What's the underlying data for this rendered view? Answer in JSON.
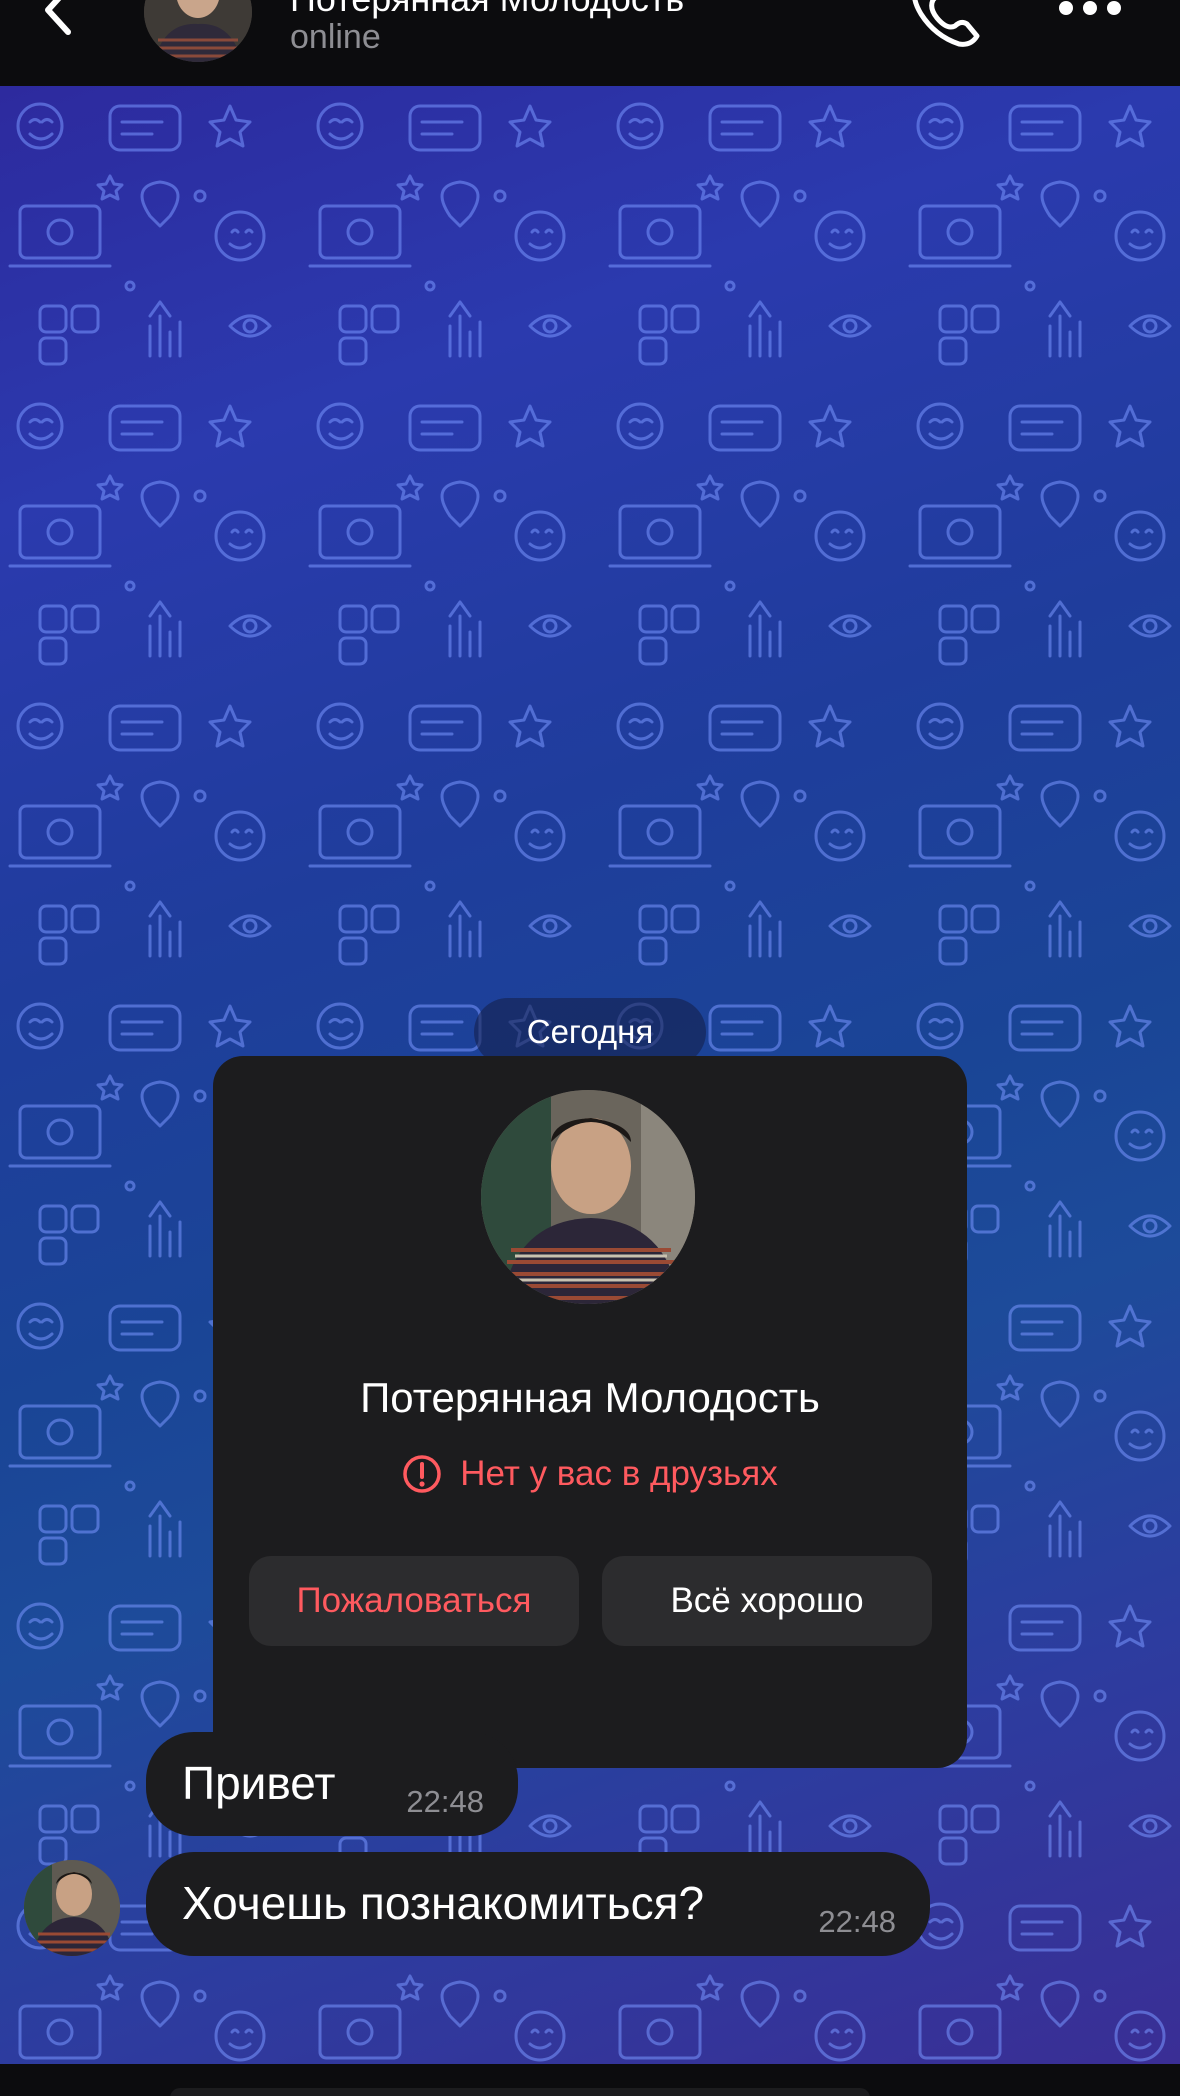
{
  "header": {
    "title": "Потерянная Молодость",
    "status": "online",
    "back_icon": "chevron-left-icon",
    "call_icon": "phone-icon",
    "more_icon": "ellipsis-icon"
  },
  "chat": {
    "date_separator": "Сегодня",
    "contact_card": {
      "name": "Потерянная Молодость",
      "warning": "Нет у вас в друзьях",
      "warning_icon": "exclamation-circle-icon",
      "report_button": "Пожаловаться",
      "ok_button": "Всё хорошо"
    },
    "messages": [
      {
        "text": "Привет",
        "time": "22:48"
      },
      {
        "text": "Хочешь познакомиться?",
        "time": "22:48"
      }
    ]
  },
  "colors": {
    "accent_red": "#ff5a5f",
    "bubble": "#1c1c1e",
    "header": "#0c0c0e"
  }
}
